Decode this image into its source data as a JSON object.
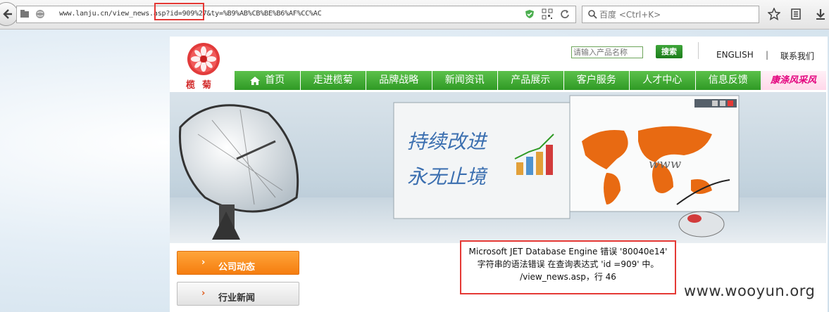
{
  "browser": {
    "url": "www.lanju.cn/view_news.asp?id=909%27&ty=%B9%AB%CB%BE%B6%AF%CC%AC",
    "search_placeholder": "百度 <Ctrl+K>"
  },
  "site": {
    "logo_text": "榄菊",
    "search_placeholder": "请输入产品名称",
    "search_button": "搜索",
    "top_links": [
      "ENGLISH",
      "联系我们"
    ],
    "top_link_separator": "|",
    "nav": [
      "首页",
      "走进榄菊",
      "品牌战略",
      "新闻资讯",
      "产品展示",
      "客户服务",
      "人才中心",
      "信息反馈"
    ],
    "nav_slogan": "康涤风采风",
    "banner": {
      "slogan_line1": "持续改进",
      "slogan_line2": "永无止境",
      "www_text": "www"
    },
    "sidebar": {
      "company_news": "公司动态",
      "industry_news": "行业新闻"
    }
  },
  "error_box": {
    "line1": "Microsoft JET Database Engine 错误 '80040e14'",
    "line2": "字符串的语法错误 在查询表达式 'id =909' 中。",
    "line3": "/view_news.asp，行 46"
  },
  "watermark": "www.wooyun.org",
  "colors": {
    "nav_green": "#3aa62f",
    "highlight_red": "#e53935",
    "orange_button": "#f8901f",
    "logo_red": "#d22a2a"
  }
}
